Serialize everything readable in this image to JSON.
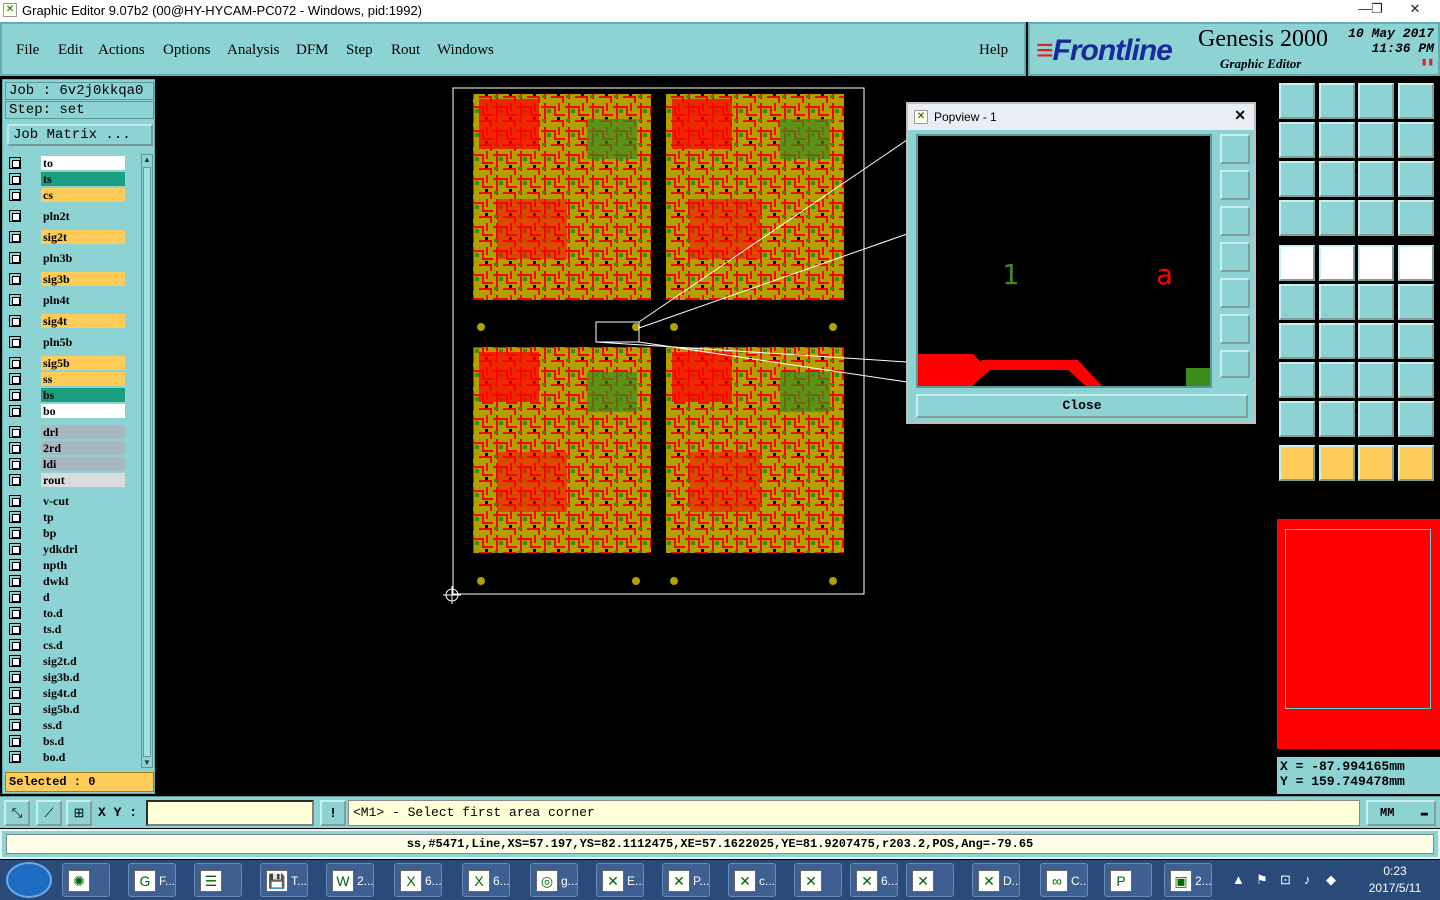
{
  "window": {
    "title": "Graphic Editor 9.07b2 (00@HY-HYCAM-PC072 - Windows, pid:1992)",
    "minimize": "—",
    "maximize": "❐",
    "close": "✕"
  },
  "menu": [
    {
      "label": "File"
    },
    {
      "label": "Edit"
    },
    {
      "label": "Actions"
    },
    {
      "label": "Options"
    },
    {
      "label": "Analysis"
    },
    {
      "label": "DFM"
    },
    {
      "label": "Step"
    },
    {
      "label": "Rout"
    },
    {
      "label": "Windows"
    }
  ],
  "help": "Help",
  "brand": {
    "logo_mark": "≡",
    "logo_text": "Frontline",
    "product": "Genesis 2000",
    "module": "Graphic Editor",
    "date": "10 May 2017",
    "time": "11:36 PM"
  },
  "job": {
    "job_line": "Job : 6v2j0kkqa0",
    "step_line": "Step: set",
    "matrix_button": "Job Matrix ..."
  },
  "colors": {
    "panel": "#8ed3d3",
    "layer_white": "#ffffff",
    "layer_green": "#1aa080",
    "layer_orange": "#ffcc5a",
    "layer_cyan": "#8ed3d3",
    "layer_gray": "#a8b8c0",
    "copper_red": "#ff0000",
    "copper_olive": "#b0a000",
    "copper_green": "#3c8c1c"
  },
  "layers": [
    {
      "name": "to",
      "color": "#ffffff"
    },
    {
      "name": "ts",
      "color": "#1aa080"
    },
    {
      "name": "cs",
      "color": "#ffcc5a"
    },
    {
      "name": "pln2t",
      "color": "#8ed3d3"
    },
    {
      "name": "sig2t",
      "color": "#ffcc5a"
    },
    {
      "name": "pln3b",
      "color": "#8ed3d3"
    },
    {
      "name": "sig3b",
      "color": "#ffcc5a"
    },
    {
      "name": "pln4t",
      "color": "#8ed3d3"
    },
    {
      "name": "sig4t",
      "color": "#ffcc5a"
    },
    {
      "name": "pln5b",
      "color": "#8ed3d3"
    },
    {
      "name": "sig5b",
      "color": "#ffcc5a"
    },
    {
      "name": "ss",
      "color": "#ffcc5a"
    },
    {
      "name": "bs",
      "color": "#1aa080"
    },
    {
      "name": "bo",
      "color": "#ffffff"
    },
    {
      "name": "drl",
      "color": "#a8b8c0"
    },
    {
      "name": "2rd",
      "color": "#a8b8c0"
    },
    {
      "name": "ldi",
      "color": "#a8b8c0"
    },
    {
      "name": "rout",
      "color": "#d8dcdc"
    },
    {
      "name": "v-cut",
      "color": "#8ed3d3"
    },
    {
      "name": "tp",
      "color": "#8ed3d3"
    },
    {
      "name": "bp",
      "color": "#8ed3d3"
    },
    {
      "name": "ydkdrl",
      "color": "#8ed3d3"
    },
    {
      "name": "npth",
      "color": "#8ed3d3"
    },
    {
      "name": "dwkl",
      "color": "#8ed3d3"
    },
    {
      "name": "d",
      "color": "#8ed3d3"
    },
    {
      "name": "to.d",
      "color": "#8ed3d3"
    },
    {
      "name": "ts.d",
      "color": "#8ed3d3"
    },
    {
      "name": "cs.d",
      "color": "#8ed3d3"
    },
    {
      "name": "sig2t.d",
      "color": "#8ed3d3"
    },
    {
      "name": "sig3b.d",
      "color": "#8ed3d3"
    },
    {
      "name": "sig4t.d",
      "color": "#8ed3d3"
    },
    {
      "name": "sig5b.d",
      "color": "#8ed3d3"
    },
    {
      "name": "ss.d",
      "color": "#8ed3d3"
    },
    {
      "name": "bs.d",
      "color": "#8ed3d3"
    },
    {
      "name": "bo.d",
      "color": "#8ed3d3"
    }
  ],
  "selected": "Selected : 0",
  "popview": {
    "title": "Popview - 1",
    "close_x": "✕",
    "label_left": "1",
    "label_right": "a",
    "close_button": "Close"
  },
  "coords": {
    "x": "X = -87.994165mm",
    "y": "Y = 159.749478mm"
  },
  "xy_label": "X Y :",
  "xy_input": "",
  "prompt": "<M1> - Select first area corner",
  "warn": "!",
  "unit": "MM",
  "status_line": "ss,#5471,Line,XS=57.197,YS=82.1112475,XE=57.1622025,YE=81.9207475,r203.2,POS,Ang=-79.65",
  "taskbar": {
    "tasks": [
      {
        "label": ""
      },
      {
        "label": "F..."
      },
      {
        "label": ""
      },
      {
        "label": "T..."
      },
      {
        "label": "2..."
      },
      {
        "label": "6..."
      },
      {
        "label": "6..."
      },
      {
        "label": "g..."
      },
      {
        "label": "E..."
      },
      {
        "label": "P..."
      },
      {
        "label": "c..."
      },
      {
        "label": ""
      },
      {
        "label": "6..."
      },
      {
        "label": ""
      },
      {
        "label": "D..."
      },
      {
        "label": "C..."
      },
      {
        "label": ""
      },
      {
        "label": "2..."
      }
    ],
    "time": "0:23",
    "date": "2017/5/11"
  }
}
